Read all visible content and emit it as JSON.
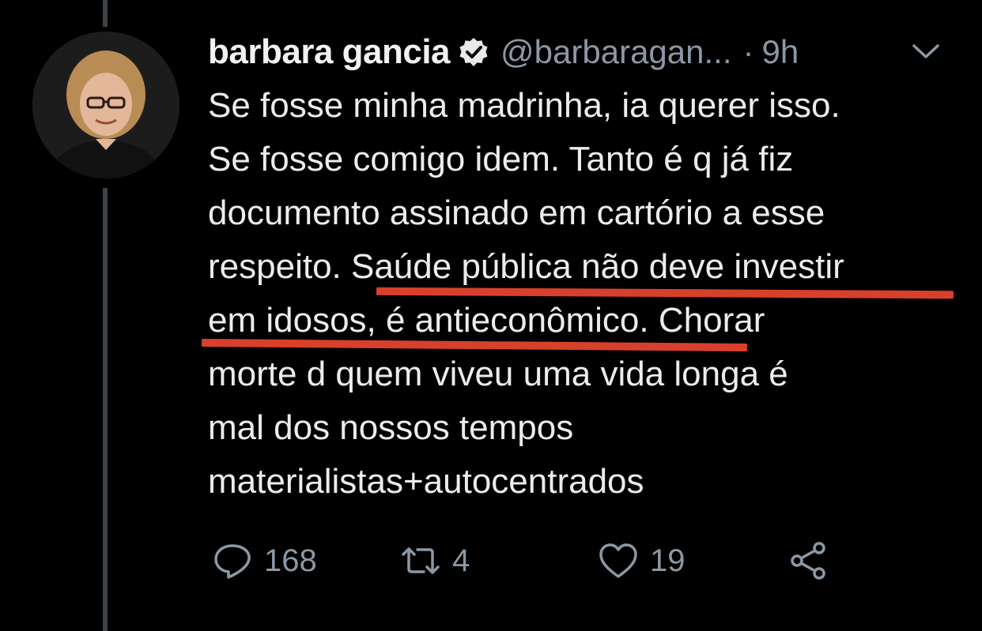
{
  "tweet": {
    "author_name": "barbara gancia",
    "handle": "@barbaragan...",
    "separator": "·",
    "time": "9h",
    "verified": true,
    "lines": [
      "Se fosse minha madrinha, ia querer isso.",
      "Se fosse comigo idem. Tanto é q já fiz",
      "documento assinado em cartório a esse",
      "respeito. Saúde pública não deve investir",
      "em idosos, é antieconômico. Chorar",
      "morte d quem viveu uma vida longa é",
      "mal dos nossos tempos",
      "materialistas+autocentrados"
    ],
    "highlight_color": "#d9402b"
  },
  "actions": {
    "reply_count": "168",
    "retweet_count": "4",
    "like_count": "19"
  },
  "icons": {
    "verified": "verified-badge-icon",
    "menu": "chevron-down-icon",
    "reply": "reply-icon",
    "retweet": "retweet-icon",
    "like": "heart-icon",
    "share": "share-icon"
  },
  "colors": {
    "background": "#000000",
    "text": "#ececec",
    "muted": "#8b98a5",
    "thread_line": "#3d4348"
  }
}
